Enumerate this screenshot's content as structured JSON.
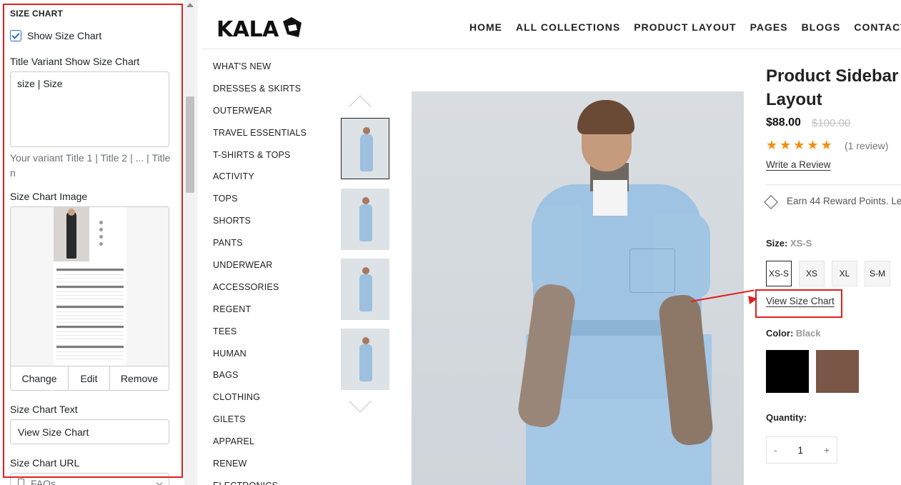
{
  "settings": {
    "section_title": "SIZE CHART",
    "show_size_chart_label": "Show Size Chart",
    "show_size_chart_checked": true,
    "title_variant_label": "Title Variant Show Size Chart",
    "title_variant_value": "size | Size",
    "title_variant_hint": "Your variant Title 1 | Title 2 | ... | Title n",
    "image_label": "Size Chart Image",
    "image_actions": [
      "Change",
      "Edit",
      "Remove"
    ],
    "text_label": "Size Chart Text",
    "text_value": "View Size Chart",
    "url_label": "Size Chart URL",
    "url_value": "FAQs"
  },
  "store": {
    "logo_text": "KALA",
    "nav": [
      "HOME",
      "ALL COLLECTIONS",
      "PRODUCT LAYOUT",
      "PAGES",
      "BLOGS",
      "CONTACT US"
    ],
    "categories": [
      "WHAT'S NEW",
      "DRESSES & SKIRTS",
      "OUTERWEAR",
      "TRAVEL ESSENTIALS",
      "T-SHIRTS & TOPS",
      "ACTIVITY",
      "TOPS",
      "SHORTS",
      "PANTS",
      "UNDERWEAR",
      "ACCESSORIES",
      "REGENT",
      "TEES",
      "HUMAN",
      "BAGS",
      "CLOTHING",
      "GILETS",
      "APPAREL",
      "RENEW",
      "ELECTRONICS"
    ],
    "product": {
      "title_line1": "Product Sidebar",
      "title_line2": "Layout",
      "price": "$88.00",
      "compare_price": "$100.00",
      "rating": 5,
      "reviews": "(1 review)",
      "write_review": "Write a Review",
      "reward": "Earn 44 Reward Points. Le",
      "size_label": "Size:",
      "size_selected": "XS-S",
      "sizes": [
        "XS-S",
        "XS",
        "XL",
        "S-M"
      ],
      "view_size_chart": "View Size Chart",
      "color_label": "Color:",
      "color_selected": "Black",
      "colors": [
        "#000000",
        "#7a5646"
      ],
      "quantity_label": "Quantity:",
      "quantity_minus": "-",
      "quantity": "1",
      "quantity_plus": "+"
    }
  },
  "colors": {
    "highlight": "#e02020",
    "star": "#f38e13",
    "checkbox": "#2c6ecb"
  }
}
